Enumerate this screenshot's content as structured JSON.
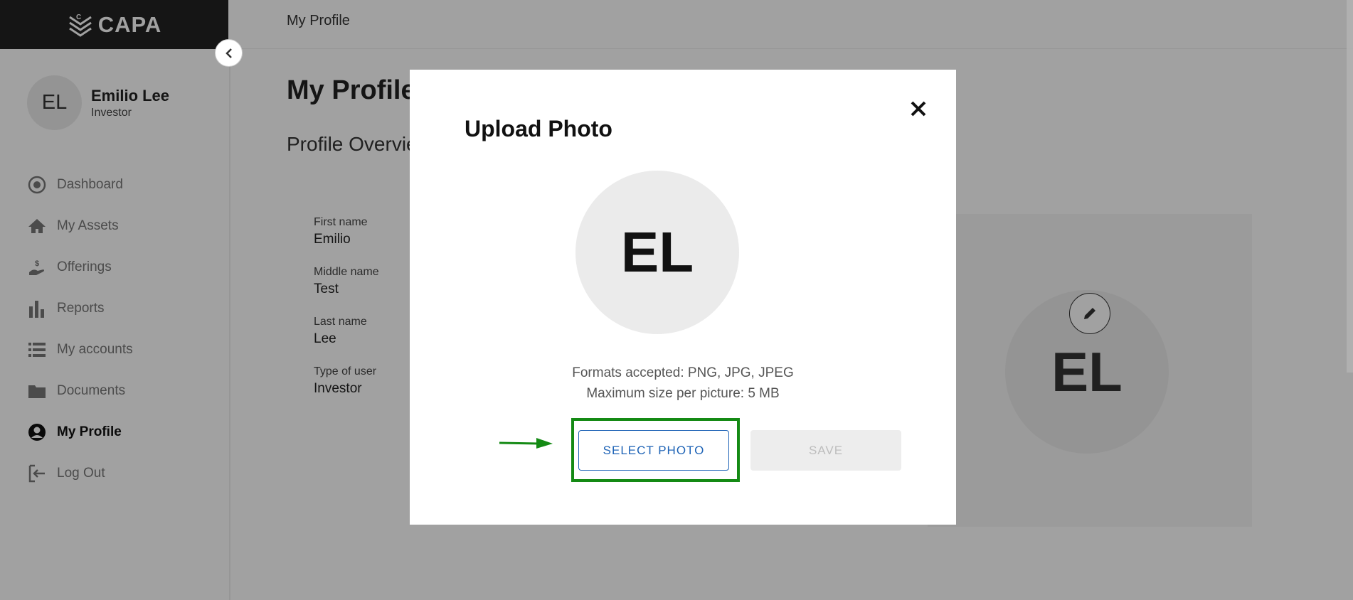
{
  "brand": {
    "logo_text": "CAPA"
  },
  "topbar": {
    "breadcrumb": "My Profile"
  },
  "user": {
    "initials": "EL",
    "name": "Emilio Lee",
    "role": "Investor"
  },
  "sidebar": {
    "items": [
      {
        "label": "Dashboard",
        "icon": "dashboard-icon",
        "active": false
      },
      {
        "label": "My Assets",
        "icon": "home-icon",
        "active": false
      },
      {
        "label": "Offerings",
        "icon": "hand-coin-icon",
        "active": false
      },
      {
        "label": "Reports",
        "icon": "bar-chart-icon",
        "active": false
      },
      {
        "label": "My accounts",
        "icon": "list-icon",
        "active": false
      },
      {
        "label": "Documents",
        "icon": "folder-icon",
        "active": false
      },
      {
        "label": "My Profile",
        "icon": "user-circle-icon",
        "active": true
      },
      {
        "label": "Log Out",
        "icon": "logout-icon",
        "active": false
      }
    ]
  },
  "main": {
    "page_title": "My Profile",
    "section_title": "Profile Overview",
    "fields": [
      {
        "label": "First name",
        "value": "Emilio"
      },
      {
        "label": "Middle name",
        "value": "Test"
      },
      {
        "label": "Last name",
        "value": "Lee"
      },
      {
        "label": "Type of user",
        "value": "Investor"
      }
    ],
    "avatar_initials": "EL"
  },
  "modal": {
    "title": "Upload Photo",
    "avatar_initials": "EL",
    "formats_line": "Formats accepted: PNG, JPG, JPEG",
    "size_line": "Maximum size per picture: 5 MB",
    "select_label": "SELECT PHOTO",
    "save_label": "SAVE"
  },
  "colors": {
    "highlight": "#148a14",
    "accent": "#1e63b6",
    "dark": "#222222"
  }
}
